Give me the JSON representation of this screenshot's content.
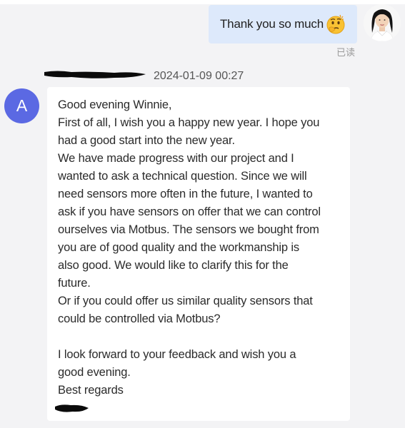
{
  "outgoing": {
    "text": "Thank you so much",
    "emoji": "thinking-face-emoji",
    "status": "已读"
  },
  "incoming": {
    "sender_initial": "A",
    "timestamp": "2024-01-09 00:27",
    "lines": [
      "Good evening Winnie,",
      "First of all, I wish you a happy new year. I hope you",
      "had a good start into the new year.",
      "We have made progress with our project and I",
      "wanted to ask a technical question. Since we will",
      "need sensors more often in the future, I wanted to",
      "ask if you have sensors on offer that we can control",
      "ourselves via Motbus. The sensors we bought from",
      "you are of good quality and the workmanship is",
      "also good. We would like to clarify this for the",
      "future.",
      "Or if you could offer us similar quality sensors that",
      "could be controlled via Motbus?",
      "",
      "I look forward to your feedback and wish you a",
      "good evening.",
      "Best regards"
    ]
  },
  "colors": {
    "outgoing_bubble": "#dde9fb",
    "incoming_bubble": "#ffffff",
    "avatar_a": "#5b69e3",
    "background": "#f3f3f5"
  }
}
